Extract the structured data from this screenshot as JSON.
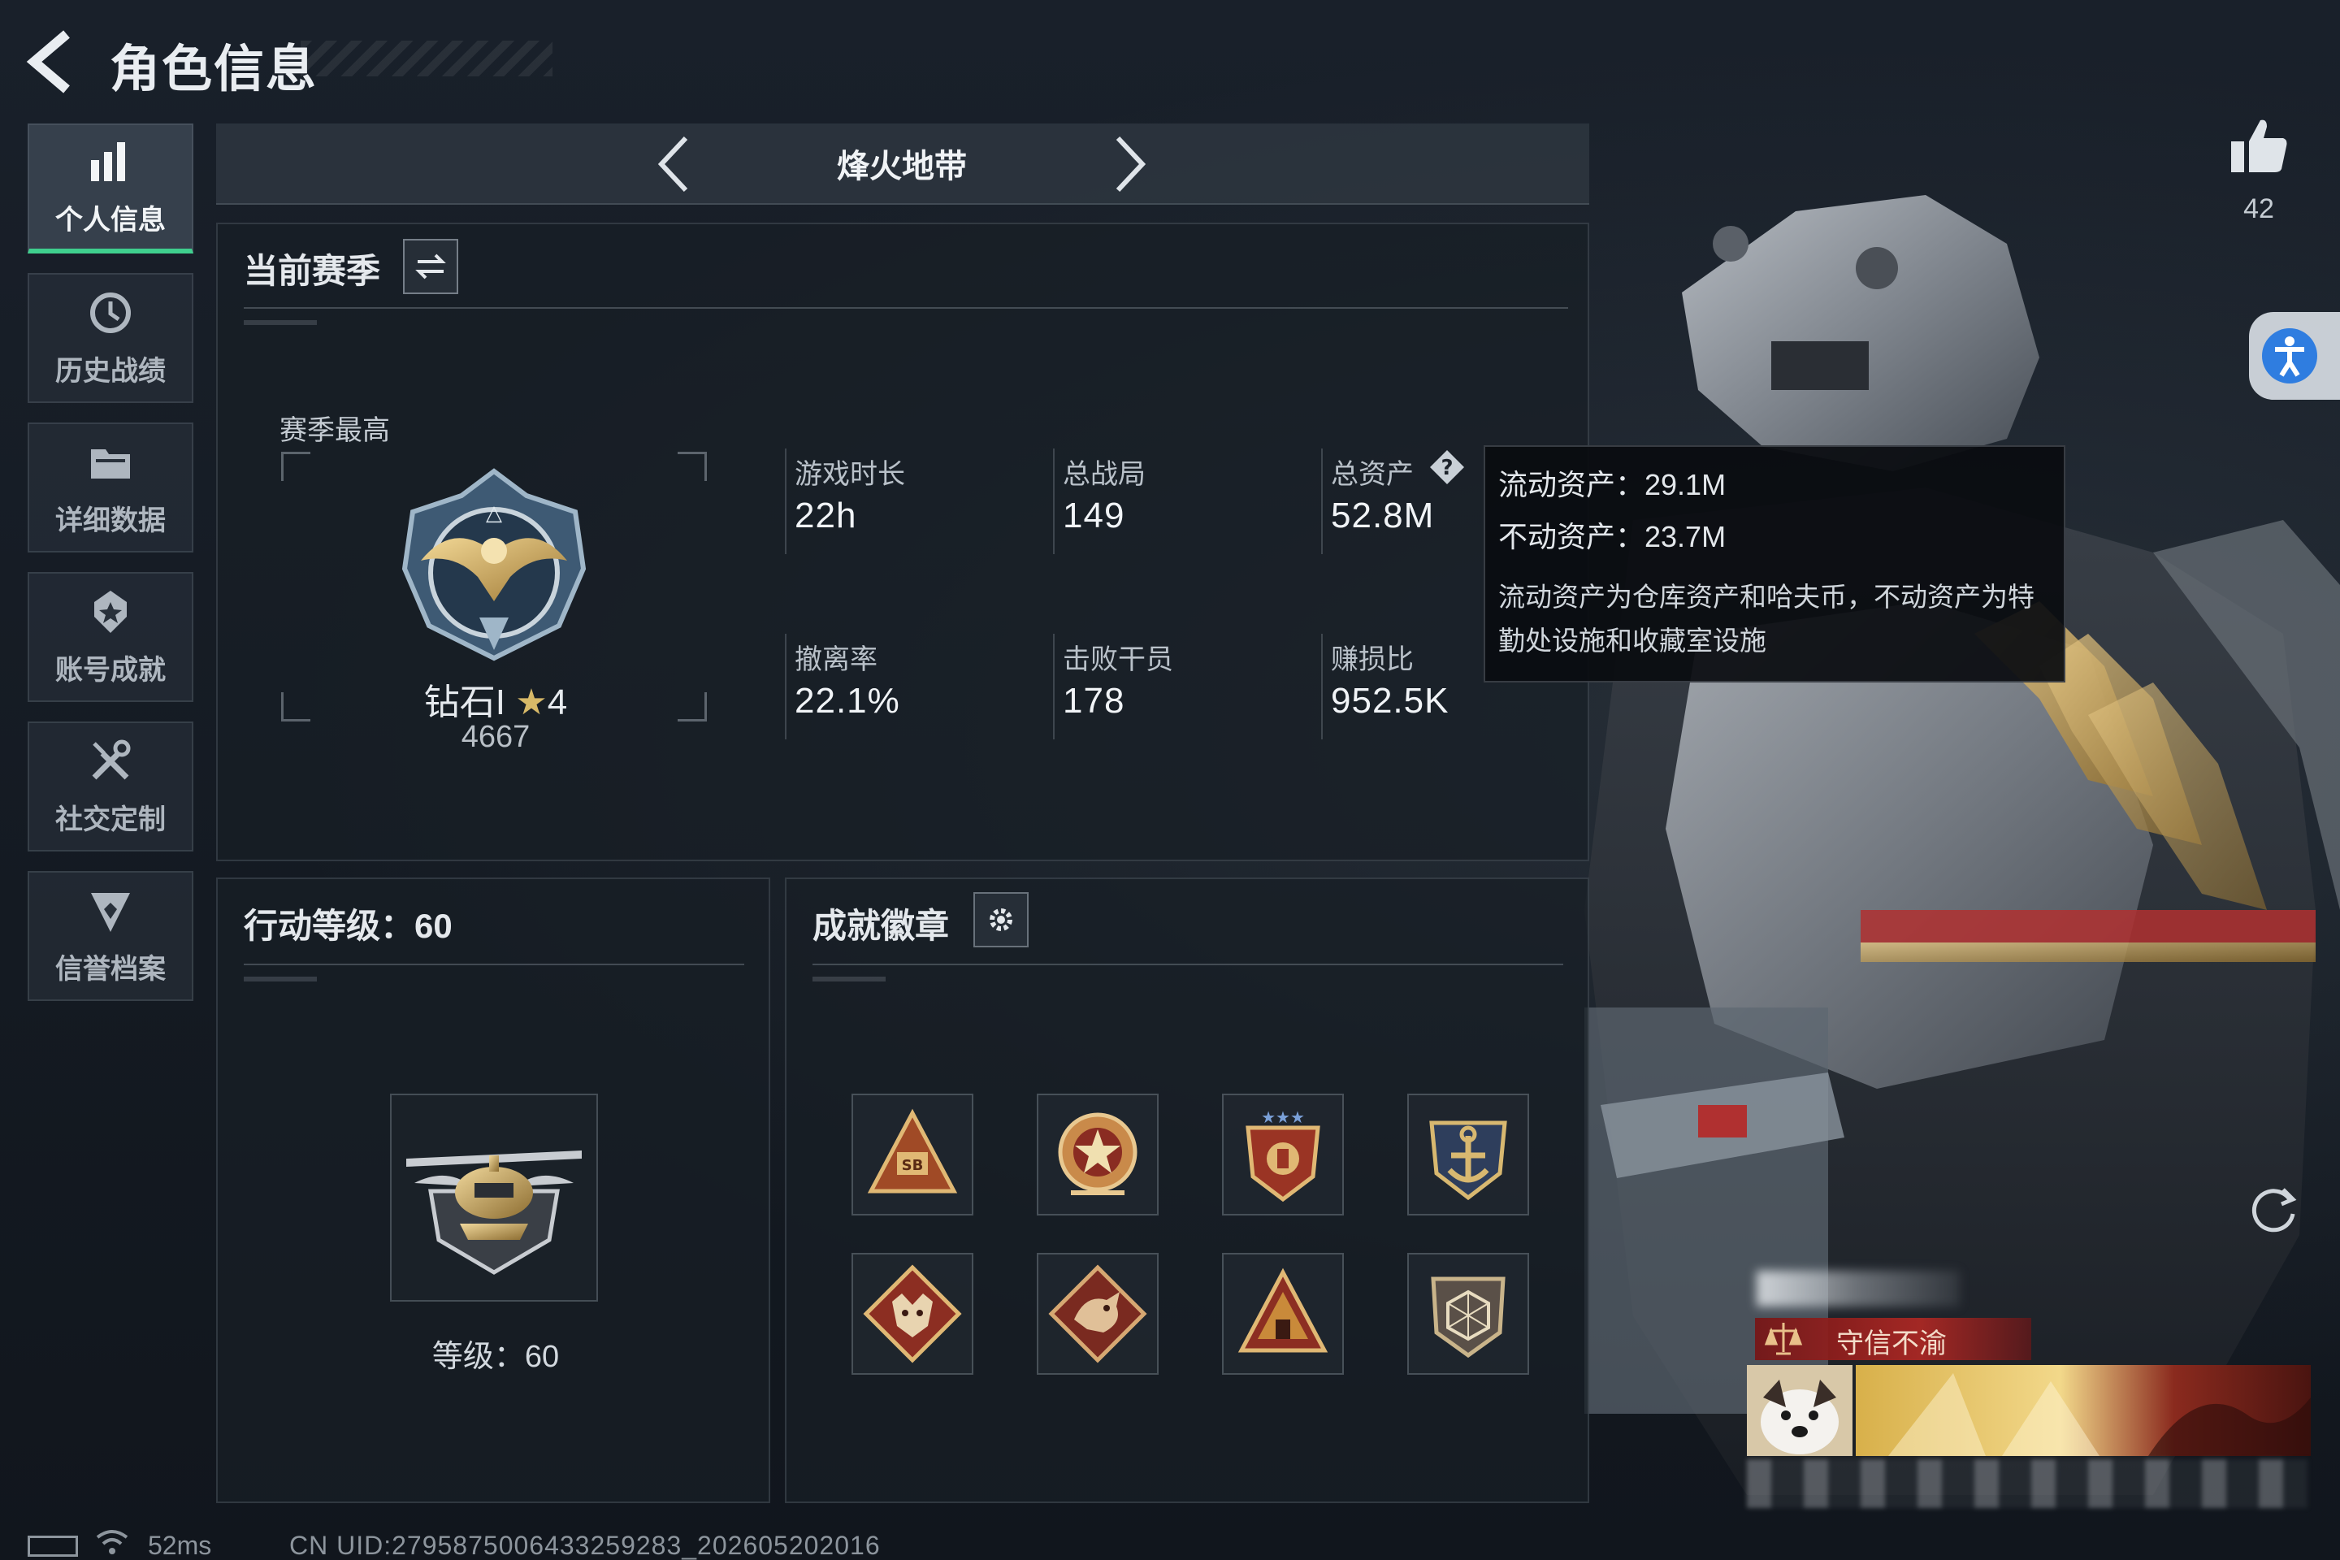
{
  "header": {
    "title": "角色信息"
  },
  "sidebar": {
    "items": [
      {
        "label": "个人信息",
        "icon": "bar-chart-icon",
        "active": true
      },
      {
        "label": "历史战绩",
        "icon": "history-clock-icon"
      },
      {
        "label": "详细数据",
        "icon": "folder-icon"
      },
      {
        "label": "账号成就",
        "icon": "achievement-star-icon"
      },
      {
        "label": "社交定制",
        "icon": "tools-icon"
      },
      {
        "label": "信誉档案",
        "icon": "reputation-shield-icon"
      }
    ]
  },
  "mode_selector": {
    "name": "烽火地带"
  },
  "season_panel": {
    "title": "当前赛季",
    "best_label": "赛季最高",
    "rank": {
      "name": "钻石I",
      "stars": "4",
      "points": "4667"
    },
    "stats": [
      {
        "label": "游戏时长",
        "value": "22h"
      },
      {
        "label": "总战局",
        "value": "149"
      },
      {
        "label": "总资产",
        "value": "52.8M"
      },
      {
        "label": "撤离率",
        "value": "22.1%"
      },
      {
        "label": "击败干员",
        "value": "178"
      },
      {
        "label": "赚损比",
        "value": "952.5K"
      }
    ]
  },
  "assets_tooltip": {
    "liquid": "流动资产：29.1M",
    "fixed": "不动资产：23.7M",
    "note": "流动资产为仓库资产和哈夫币，不动资产为特勤处设施和收藏室设施"
  },
  "level_panel": {
    "title": "行动等级：60",
    "level_text": "等级：60"
  },
  "badge_panel": {
    "title": "成就徽章",
    "badges": [
      "triangle-sb-badge-icon",
      "star-wreath-badge-icon",
      "stars-shield-badge-icon",
      "anchor-shield-badge-icon",
      "wolf-diamond-badge-icon",
      "dragon-diamond-badge-icon",
      "pyramid-badge-icon",
      "d20-shield-badge-icon"
    ]
  },
  "social": {
    "like_count": "42",
    "honor_title": "守信不渝"
  },
  "status_bar": {
    "ping": "52ms",
    "uid": "CN UID:2795875006433259283_202605202016"
  },
  "colors": {
    "accent_green": "#3fcf8e",
    "background": "#141a22",
    "honor_red": "#a82a24"
  }
}
